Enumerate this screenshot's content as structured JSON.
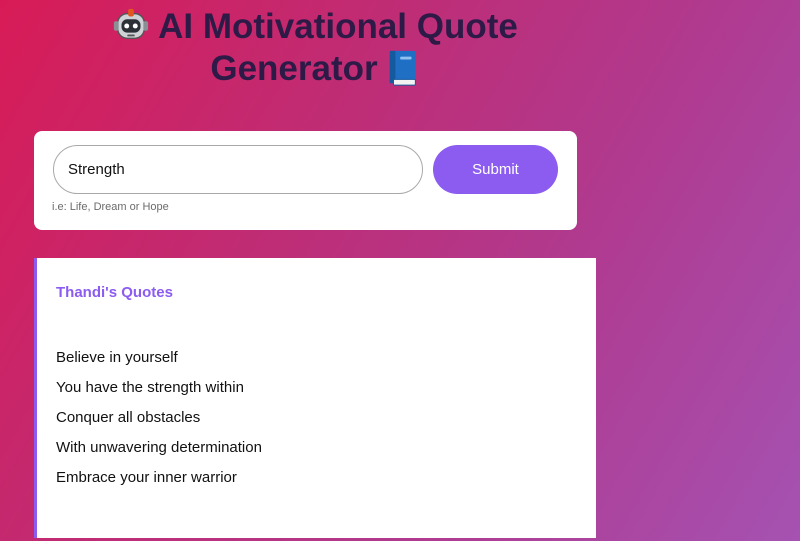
{
  "header": {
    "title": "AI Motivational Quote Generator",
    "title_line1": "AI Motivational Quote",
    "title_line2": "Generator",
    "icons": [
      "robot-icon",
      "book-icon"
    ]
  },
  "form": {
    "input_value": "Strength",
    "submit_label": "Submit",
    "hint": "i.e: Life, Dream or Hope"
  },
  "quotes": {
    "heading": "Thandi's Quotes",
    "lines": [
      "Believe in yourself",
      "You have the strength within",
      "Conquer all obstacles",
      "With unwavering determination",
      "Embrace your inner warrior"
    ]
  },
  "colors": {
    "accent": "#8c5cf1",
    "title_text": "#2e1a47",
    "background_start": "#d81b57",
    "background_end": "#a552b2"
  }
}
